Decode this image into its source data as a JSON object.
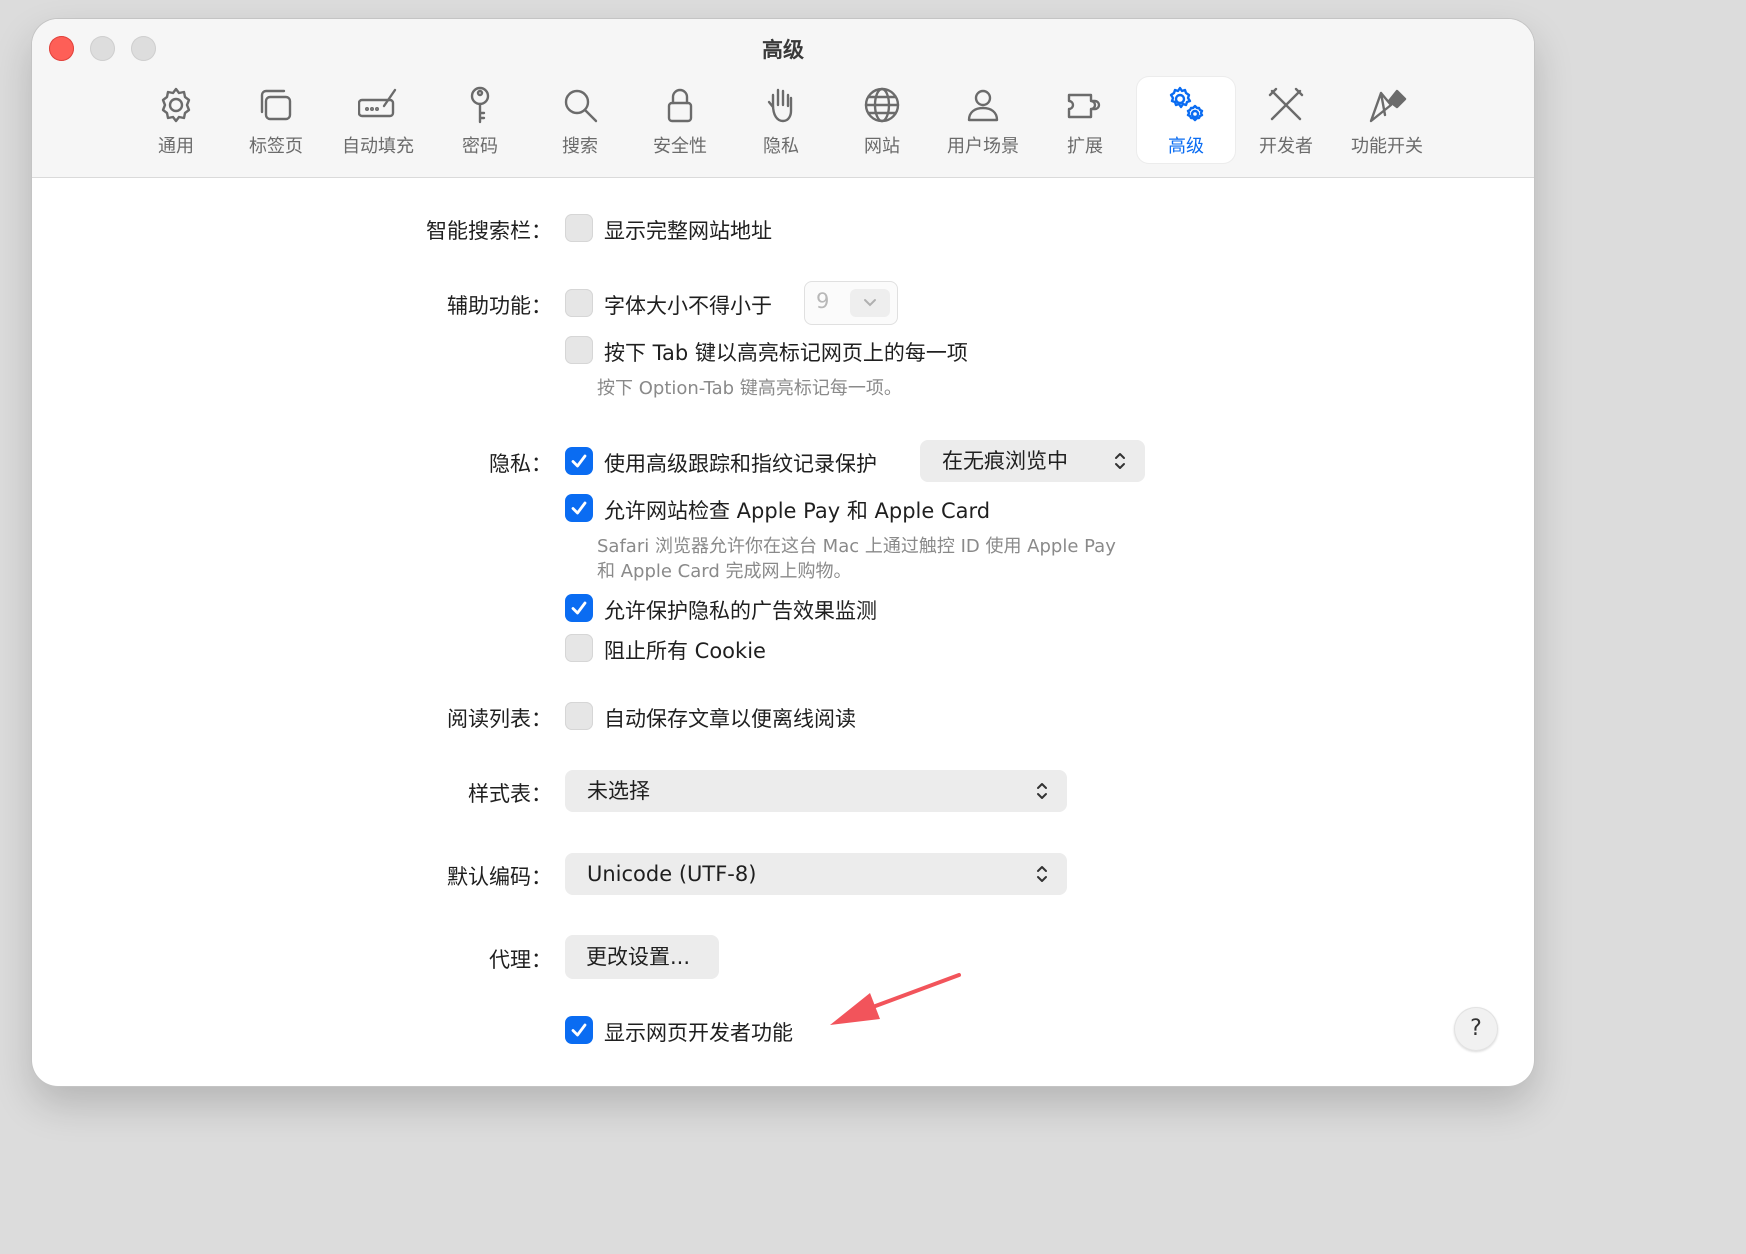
{
  "window": {
    "title": "高级"
  },
  "tabs": [
    {
      "id": "general",
      "label": "通用",
      "icon": "gear-icon",
      "active": false
    },
    {
      "id": "tabs",
      "label": "标签页",
      "icon": "tabs-icon",
      "active": false
    },
    {
      "id": "autofill",
      "label": "自动填充",
      "icon": "pen-field-icon",
      "active": false
    },
    {
      "id": "passwords",
      "label": "密码",
      "icon": "key-icon",
      "active": false
    },
    {
      "id": "search",
      "label": "搜索",
      "icon": "magnifier-icon",
      "active": false
    },
    {
      "id": "security",
      "label": "安全性",
      "icon": "lock-icon",
      "active": false
    },
    {
      "id": "privacy",
      "label": "隐私",
      "icon": "hand-icon",
      "active": false
    },
    {
      "id": "websites",
      "label": "网站",
      "icon": "globe-icon",
      "active": false
    },
    {
      "id": "profiles",
      "label": "用户场景",
      "icon": "person-icon",
      "active": false
    },
    {
      "id": "extensions",
      "label": "扩展",
      "icon": "puzzle-icon",
      "active": false
    },
    {
      "id": "advanced",
      "label": "高级",
      "icon": "gears-icon",
      "active": true
    },
    {
      "id": "developer",
      "label": "开发者",
      "icon": "tools-icon",
      "active": false
    },
    {
      "id": "feature_flags",
      "label": "功能开关",
      "icon": "flags-icon",
      "active": false
    }
  ],
  "smart_search": {
    "label": "智能搜索栏：",
    "show_full_address": {
      "label": "显示完整网站地址",
      "checked": false
    }
  },
  "accessibility": {
    "label": "辅助功能：",
    "min_font": {
      "label": "字体大小不得小于",
      "checked": false,
      "value": "9"
    },
    "tab_highlight": {
      "label": "按下 Tab 键以高亮标记网页上的每一项",
      "checked": false
    },
    "note": "按下 Option-Tab 键高亮标记每一项。"
  },
  "privacy": {
    "label": "隐私：",
    "advanced_tracking": {
      "label": "使用高级跟踪和指纹记录保护",
      "checked": true,
      "mode": "在无痕浏览中"
    },
    "apple_pay": {
      "label": "允许网站检查 Apple Pay 和 Apple Card",
      "checked": true
    },
    "apple_pay_note_1": "Safari 浏览器允许你在这台 Mac 上通过触控 ID 使用 Apple Pay",
    "apple_pay_note_2": "和 Apple Card 完成网上购物。",
    "ad_measurement": {
      "label": "允许保护隐私的广告效果监测",
      "checked": true
    },
    "block_cookies": {
      "label": "阻止所有 Cookie",
      "checked": false
    }
  },
  "reading_list": {
    "label": "阅读列表：",
    "save_offline": {
      "label": "自动保存文章以便离线阅读",
      "checked": false
    }
  },
  "style_sheet": {
    "label": "样式表：",
    "value": "未选择"
  },
  "default_encoding": {
    "label": "默认编码：",
    "value": "Unicode (UTF-8)"
  },
  "proxies": {
    "label": "代理：",
    "button": "更改设置..."
  },
  "develop_menu": {
    "label": "显示网页开发者功能",
    "checked": true
  },
  "help": {
    "label": "?"
  },
  "colors": {
    "accent": "#0a6cf2",
    "arrow": "#f2545b"
  }
}
